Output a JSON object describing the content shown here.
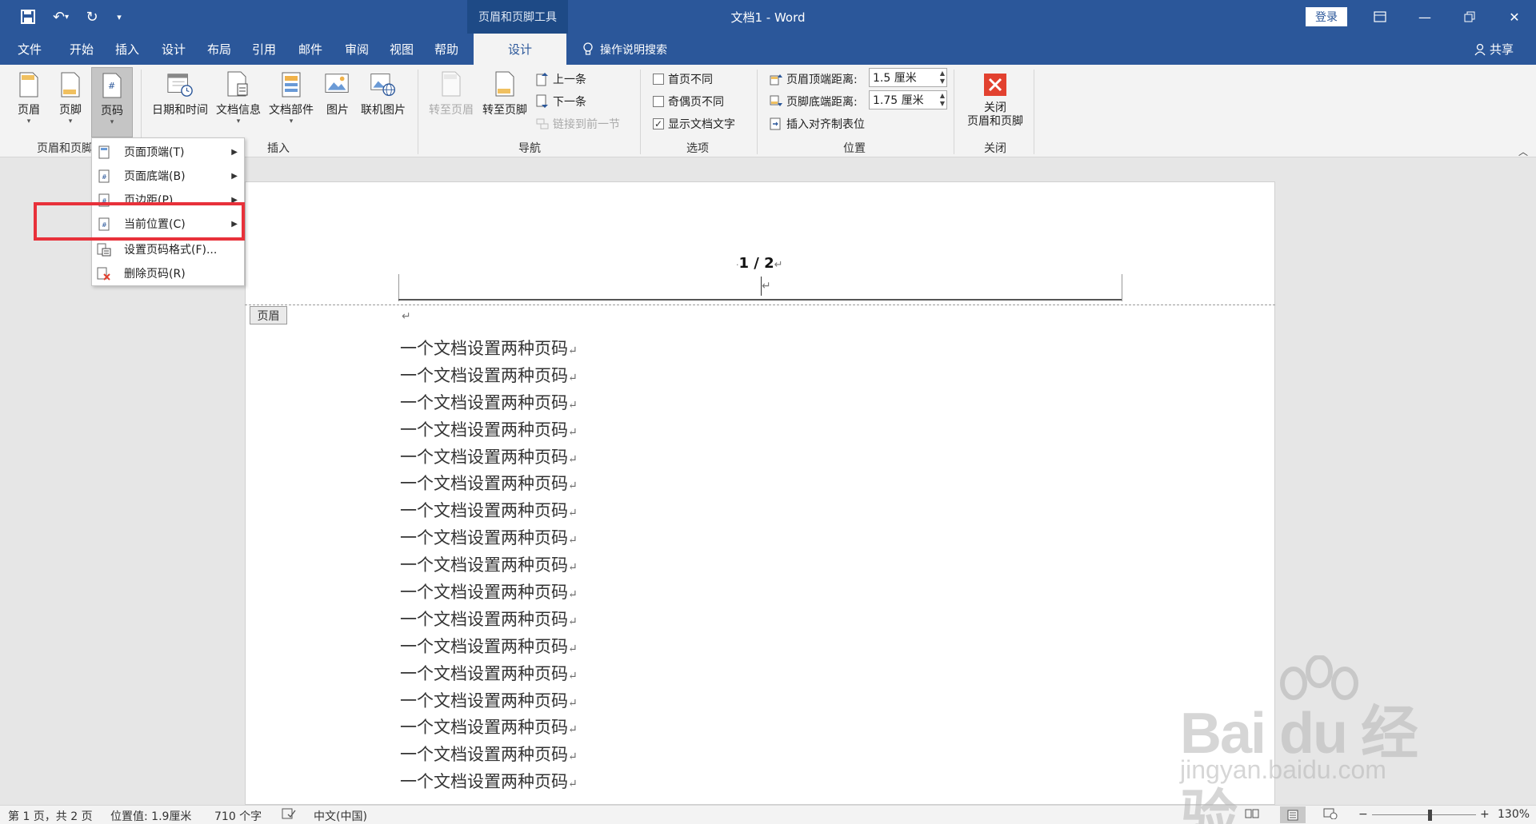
{
  "colors": {
    "accent": "#2b579a",
    "highlight": "#e8313a"
  },
  "titlebar": {
    "tool_tab_title": "页眉和页脚工具",
    "doc_title": "文档1 - Word",
    "login": "登录"
  },
  "tabs": [
    {
      "label": "文件"
    },
    {
      "label": "开始"
    },
    {
      "label": "插入"
    },
    {
      "label": "设计"
    },
    {
      "label": "布局"
    },
    {
      "label": "引用"
    },
    {
      "label": "邮件"
    },
    {
      "label": "审阅"
    },
    {
      "label": "视图"
    },
    {
      "label": "帮助"
    }
  ],
  "active_tab": "设计",
  "tell_me": "操作说明搜索",
  "share": "共享",
  "ribbon": {
    "header": "页眉",
    "footer": "页脚",
    "page_number": "页码",
    "group_header_footer": "页眉和页脚",
    "date_time": "日期和时间",
    "doc_info": "文档信息",
    "doc_parts": "文档部件",
    "picture": "图片",
    "online_picture": "联机图片",
    "group_insert": "插入",
    "goto_header": "转至页眉",
    "goto_footer": "转至页脚",
    "previous": "上一条",
    "next": "下一条",
    "link_previous": "链接到前一节",
    "group_nav": "导航",
    "diff_first": "首页不同",
    "diff_odd_even": "奇偶页不同",
    "show_text": "显示文档文字",
    "group_options": "选项",
    "header_top": "页眉顶端距离:",
    "header_top_value": "1.5 厘米",
    "footer_bottom": "页脚底端距离:",
    "footer_bottom_value": "1.75 厘米",
    "insert_tab": "插入对齐制表位",
    "group_position": "位置",
    "close_line1": "关闭",
    "close_line2": "页眉和页脚",
    "group_close": "关闭"
  },
  "menu": {
    "items": [
      {
        "label": "页面顶端(T)",
        "sub": true
      },
      {
        "label": "页面底端(B)",
        "sub": true
      },
      {
        "label": "页边距(P)",
        "sub": true
      },
      {
        "label": "当前位置(C)",
        "sub": true
      },
      {
        "label": "设置页码格式(F)...",
        "sub": false
      },
      {
        "label": "删除页码(R)",
        "sub": false
      }
    ]
  },
  "document": {
    "page_number": "1 / 2",
    "header_tag": "页眉",
    "line_text": "一个文档设置两种页码",
    "line_count": 17
  },
  "status": {
    "page": "第 1 页，共 2 页",
    "position": "位置值: 1.9厘米",
    "words": "710 个字",
    "language": "中文(中国)",
    "zoom": "130%",
    "zoom_fraction": 0.55
  },
  "watermark": {
    "brand": "Bai du 经验",
    "url": "jingyan.baidu.com"
  }
}
